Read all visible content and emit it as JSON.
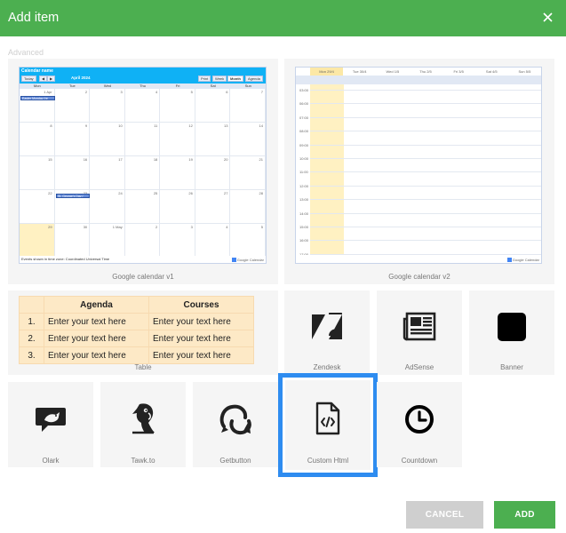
{
  "dialog": {
    "title": "Add item",
    "section_label": "Advanced"
  },
  "tiles": {
    "gcal1": {
      "label": "Google calendar v1",
      "preview": {
        "calendar_name": "Calendar name",
        "today_btn": "Today",
        "month_label": "April 2024",
        "print_btn": "Print",
        "view_tabs": [
          "Week",
          "Month",
          "Agenda"
        ],
        "weekdays": [
          "Mon",
          "Tue",
          "Wed",
          "Thu",
          "Fri",
          "Sat",
          "Sun"
        ],
        "days": [
          "1 Apr",
          "2",
          "3",
          "4",
          "5",
          "6",
          "7",
          "8",
          "9",
          "10",
          "11",
          "12",
          "13",
          "14",
          "15",
          "16",
          "17",
          "18",
          "19",
          "20",
          "21",
          "22",
          "23",
          "24",
          "25",
          "26",
          "27",
          "28",
          "29",
          "30",
          "1 May",
          "2",
          "3",
          "4",
          "5"
        ],
        "events": [
          "Easter Monday (re",
          "St. George's Day ("
        ],
        "footer": "Events shown in time zone: Coordinated Universal Time",
        "badge": "Google Calendar"
      }
    },
    "gcal2": {
      "label": "Google calendar v2",
      "preview": {
        "days": [
          "Mon 29/4",
          "Tue 30/4",
          "Wed 1/5",
          "Thu 2/5",
          "Fri 3/5",
          "Sat 4/5",
          "Sun 5/5"
        ],
        "hours": [
          "03:00",
          "06:00",
          "07:00",
          "08:00",
          "09:00",
          "10:00",
          "11:00",
          "12:00",
          "13:00",
          "14:00",
          "15:00",
          "16:00",
          "17:00"
        ],
        "badge": "Google Calendar"
      }
    },
    "table": {
      "label": "Table",
      "headers": [
        "Agenda",
        "Courses"
      ],
      "rows": [
        [
          "1.",
          "Enter your text here",
          "Enter your text here"
        ],
        [
          "2.",
          "Enter your text here",
          "Enter your text here"
        ],
        [
          "3.",
          "Enter your text here",
          "Enter your text here"
        ]
      ]
    },
    "zendesk": {
      "label": "Zendesk"
    },
    "adsense": {
      "label": "AdSense"
    },
    "banner": {
      "label": "Banner"
    },
    "olark": {
      "label": "Olark"
    },
    "tawkto": {
      "label": "Tawk.to"
    },
    "getbutton": {
      "label": "Getbutton"
    },
    "custom_html": {
      "label": "Custom Html"
    },
    "countdown": {
      "label": "Countdown"
    }
  },
  "actions": {
    "cancel_label": "CANCEL",
    "add_label": "ADD"
  },
  "colors": {
    "header": "#4caf50",
    "add_button": "#4caf50",
    "cancel_button": "#cfcfcf",
    "selection": "#2e8cf0",
    "tile_bg": "#f5f5f5"
  }
}
